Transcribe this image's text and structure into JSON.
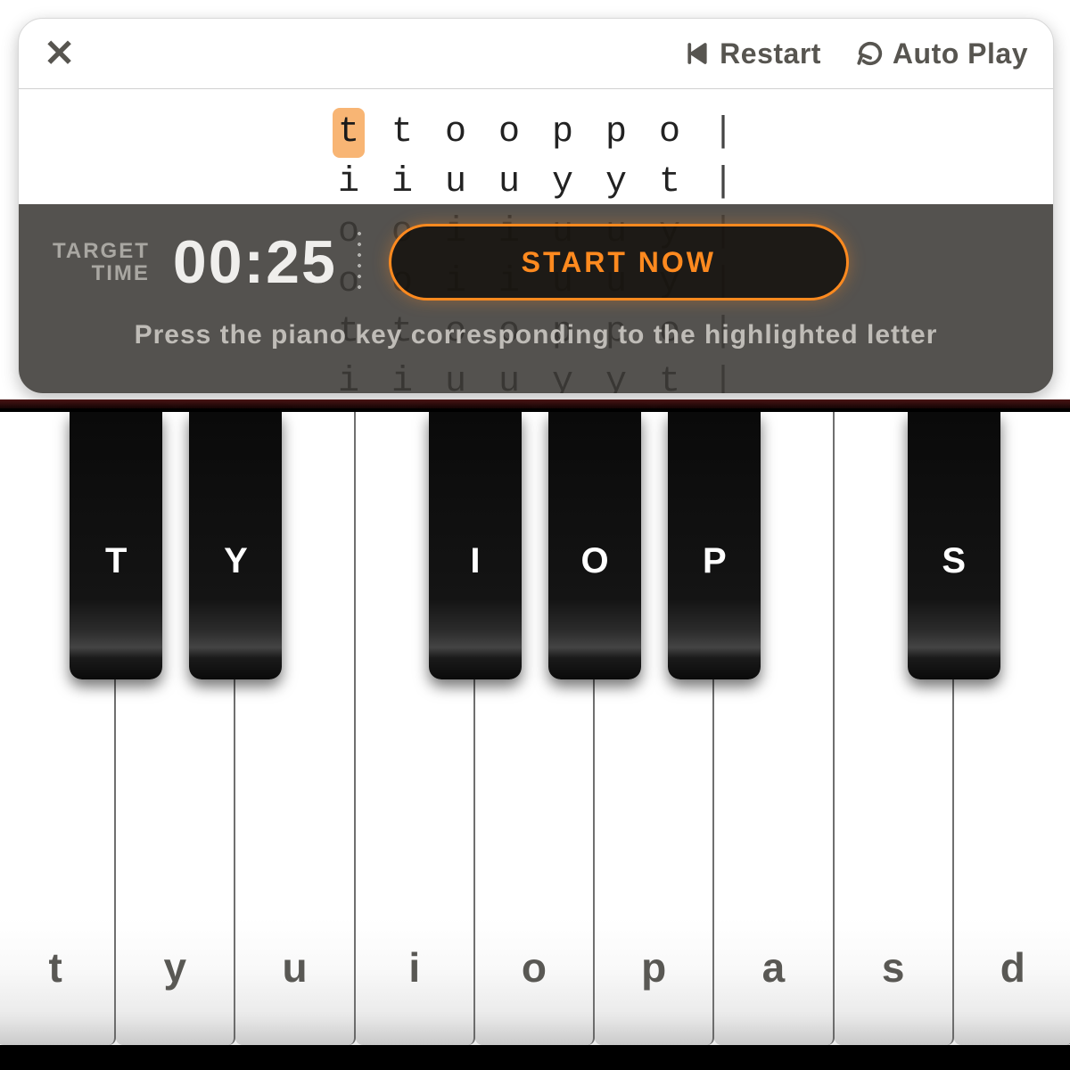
{
  "topbar": {
    "restart_label": "Restart",
    "autoplay_label": "Auto Play"
  },
  "letters": {
    "highlight_index": 0,
    "rows": [
      [
        "t",
        "t",
        "o",
        "o",
        "p",
        "p",
        "o"
      ],
      [
        "i",
        "i",
        "u",
        "u",
        "y",
        "y",
        "t"
      ],
      [
        "o",
        "o",
        "i",
        "i",
        "u",
        "u",
        "y"
      ],
      [
        "o",
        "o",
        "i",
        "i",
        "u",
        "u",
        "y"
      ],
      [
        "t",
        "t",
        "o",
        "o",
        "p",
        "p",
        "o"
      ],
      [
        "i",
        "i",
        "u",
        "u",
        "y",
        "y",
        "t"
      ]
    ]
  },
  "overlay": {
    "target_label_line1": "TARGET",
    "target_label_line2": "TIME",
    "timer_value": "00:25",
    "start_label": "START NOW",
    "hint": "Press the piano key corresponding to the highlighted letter"
  },
  "piano": {
    "white_keys": [
      "t",
      "y",
      "u",
      "i",
      "o",
      "p",
      "a",
      "s",
      "d"
    ],
    "black_keys": [
      {
        "label": "T",
        "after_white_index": 0
      },
      {
        "label": "Y",
        "after_white_index": 1
      },
      {
        "label": "I",
        "after_white_index": 3
      },
      {
        "label": "O",
        "after_white_index": 4
      },
      {
        "label": "P",
        "after_white_index": 5
      },
      {
        "label": "S",
        "after_white_index": 7
      }
    ]
  }
}
